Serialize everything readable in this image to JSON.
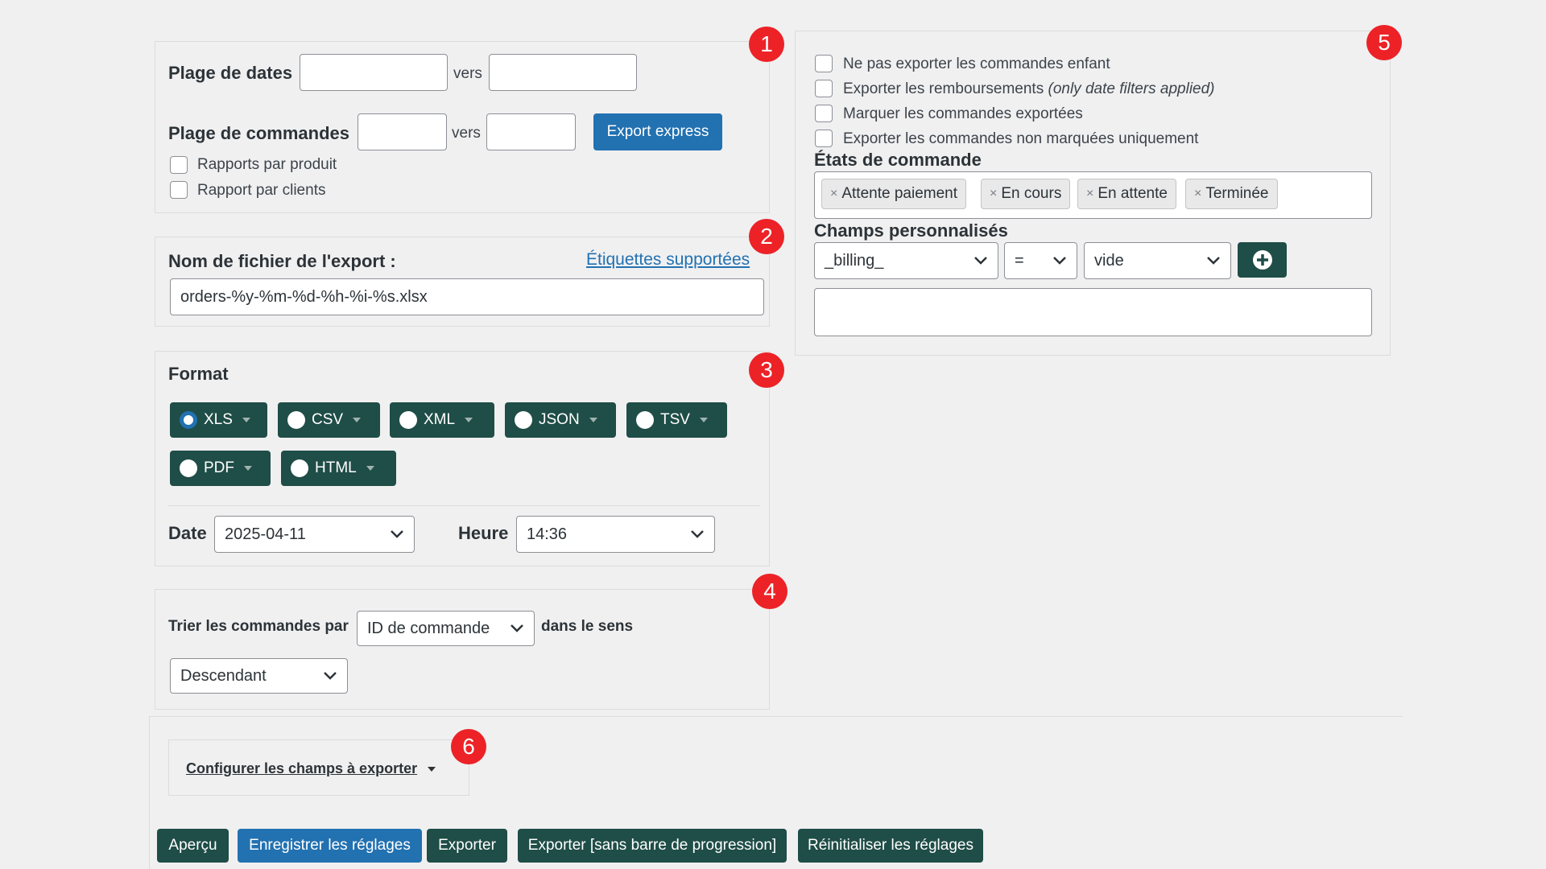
{
  "section_dates": {
    "date_range_label": "Plage de dates",
    "vers_1": "vers",
    "order_range_label": "Plage de commandes",
    "vers_2": "vers",
    "export_express_label": "Export express",
    "checkbox_products_label": "Rapports par produit",
    "checkbox_clients_label": "Rapport par clients",
    "badge": "1"
  },
  "section_filename": {
    "label": "Nom de fichier de l'export :",
    "tags_link": "Étiquettes supportées",
    "filename_value": "orders-%y-%m-%d-%h-%i-%s.xlsx",
    "badge": "2"
  },
  "section_format": {
    "title": "Format",
    "badge": "3",
    "formats": [
      {
        "label": "XLS",
        "checked": true
      },
      {
        "label": "CSV",
        "checked": false
      },
      {
        "label": "XML",
        "checked": false
      },
      {
        "label": "JSON",
        "checked": false
      },
      {
        "label": "TSV",
        "checked": false
      },
      {
        "label": "PDF",
        "checked": false
      },
      {
        "label": "HTML",
        "checked": false
      }
    ],
    "date_label": "Date",
    "date_value": "2025-04-11",
    "time_label": "Heure",
    "time_value": "14:36"
  },
  "section_sort": {
    "sort_label": "Trier les commandes par",
    "sort_value": "ID de commande",
    "direction_label": "dans le sens",
    "direction_value": "Descendant",
    "badge": "4"
  },
  "section_options": {
    "badge": "5",
    "checkboxes": [
      {
        "label": "Ne pas exporter les commandes enfant",
        "note": ""
      },
      {
        "label": "Exporter les remboursements",
        "note": "(only date filters applied)"
      },
      {
        "label": "Marquer les commandes exportées",
        "note": ""
      },
      {
        "label": "Exporter les commandes non marquées uniquement",
        "note": ""
      }
    ],
    "order_states_label": "États de commande",
    "order_states": [
      "Attente paiement",
      "En cours",
      "En attente",
      "Terminée"
    ],
    "tag_remove_glyph": "×",
    "custom_fields_label": "Champs personnalisés",
    "custom_field_value": "_billing_",
    "operator_value": "=",
    "compare_value": "vide",
    "add_icon": "plus-circle-icon"
  },
  "section_fields": {
    "configure_label": "Configurer les champs à exporter",
    "badge": "6"
  },
  "footer_buttons": {
    "preview": "Aperçu",
    "save": "Enregistrer les réglages",
    "export": "Exporter",
    "export_no_progress": "Exporter [sans barre de progression]",
    "reset": "Réinitialiser les réglages"
  },
  "colors": {
    "accent_blue": "#2271b1",
    "dark_green": "#1f4d47",
    "badge_red": "#ec2227",
    "background": "#f0f0f1"
  }
}
